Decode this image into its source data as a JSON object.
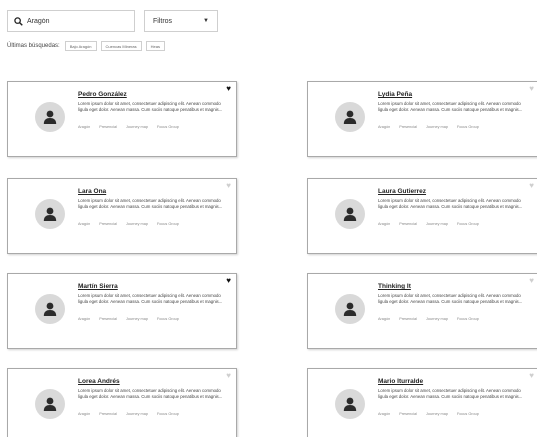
{
  "search": {
    "value": "Aragón"
  },
  "filters": {
    "label": "Filtros",
    "caret": "▼"
  },
  "recent": {
    "label": "Últimas búsquedas:",
    "chips": [
      "Bajo Aragón",
      "Cuencas Mineras",
      "Heas"
    ]
  },
  "card_text": {
    "description": "Lorem ipsum dolor sit amet, consectetuer adipiscing elit. Aenean commodo ligula eget dolor. Aenean massa. Cum sociis natoque penatibus et magnis...",
    "tags": [
      "Aragón",
      "Presencial",
      "Journey map",
      "Focus Group"
    ]
  },
  "cards": [
    {
      "name": "Pedro González",
      "favorite": true
    },
    {
      "name": "Lydia Peña",
      "favorite": false
    },
    {
      "name": "Lara Ona",
      "favorite": false
    },
    {
      "name": "Laura Gutierrez",
      "favorite": false
    },
    {
      "name": "Martín Sierra",
      "favorite": true
    },
    {
      "name": "Thinking It",
      "favorite": false
    },
    {
      "name": "Lorea Andrés",
      "favorite": false
    },
    {
      "name": "Mario Iturralde",
      "favorite": false
    }
  ],
  "icons": {
    "search": "search-icon",
    "avatar": "person-icon",
    "favorite": "heart-icon"
  },
  "colors": {
    "border": "#a9a9a9",
    "avatar_bg": "#d9d9d9",
    "heart_on": "#111111",
    "heart_off": "#cfcfcf"
  }
}
